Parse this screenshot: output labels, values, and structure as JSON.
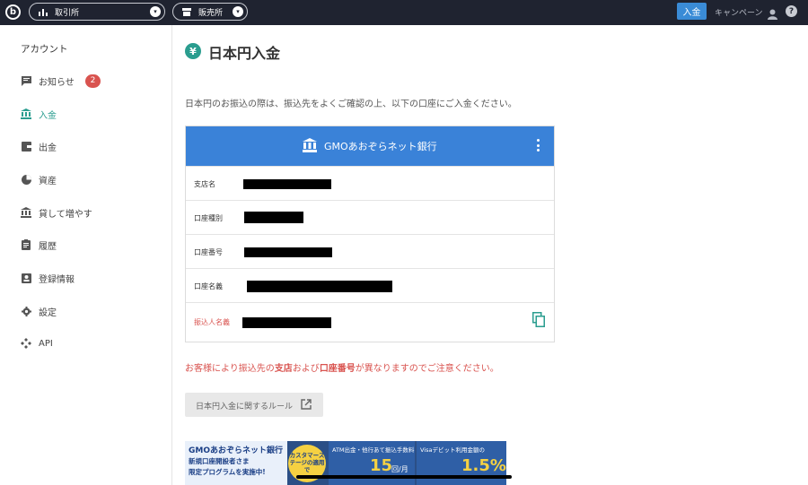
{
  "header": {
    "logo_letter": "b",
    "exchange_pill": "取引所",
    "store_pill": "販売所",
    "deposit_button": "入金",
    "campaign_link": "キャンペーン",
    "help_glyph": "?"
  },
  "sidebar": {
    "heading": "アカウント",
    "items": [
      {
        "label": "お知らせ",
        "icon": "message-icon",
        "badge": "2"
      },
      {
        "label": "入金",
        "icon": "bank-icon",
        "active": true
      },
      {
        "label": "出金",
        "icon": "wallet-icon"
      },
      {
        "label": "資産",
        "icon": "pie-chart-icon"
      },
      {
        "label": "貸して増やす",
        "icon": "bank-icon"
      },
      {
        "label": "履歴",
        "icon": "clipboard-icon"
      },
      {
        "label": "登録情報",
        "icon": "id-card-icon"
      },
      {
        "label": "設定",
        "icon": "gear-icon"
      },
      {
        "label": "API",
        "icon": "api-icon"
      }
    ]
  },
  "main": {
    "yen_glyph": "¥",
    "title": "日本円入金",
    "intro": "日本円のお振込の際は、振込先をよくご確認の上、以下の口座にご入金ください。",
    "bank": {
      "name": "GMOあおぞらネット銀行",
      "rows": [
        {
          "label": "支店名"
        },
        {
          "label": "口座種別"
        },
        {
          "label": "口座番号"
        },
        {
          "label": "口座名義"
        },
        {
          "label": "振込人名義"
        }
      ]
    },
    "warning": {
      "part1": "お客様により振込先の",
      "bold1": "支店",
      "part2": "および",
      "bold2": "口座番号",
      "part3": "が異なりますのでご注意ください。"
    },
    "rule_button": "日本円入金に関するルール",
    "banner": {
      "brand": "GMOあおぞらネット銀行",
      "line1": "新規口座開設者さま",
      "line2": "限定プログラムを実施中!",
      "badge": "カスタマーステージの適用で",
      "atm_title": "ATM出金・他行あて振込手数料",
      "atm_value": "15",
      "atm_unit": "回/月",
      "visa_title": "Visaデビット利用金額の",
      "visa_value": "1.5%"
    }
  },
  "colors": {
    "topbar": "#1f2330",
    "accent": "#2a9d8f",
    "bank_header": "#3a82d8",
    "warning": "#d9534f",
    "deposit_button": "#3a8bd6"
  }
}
